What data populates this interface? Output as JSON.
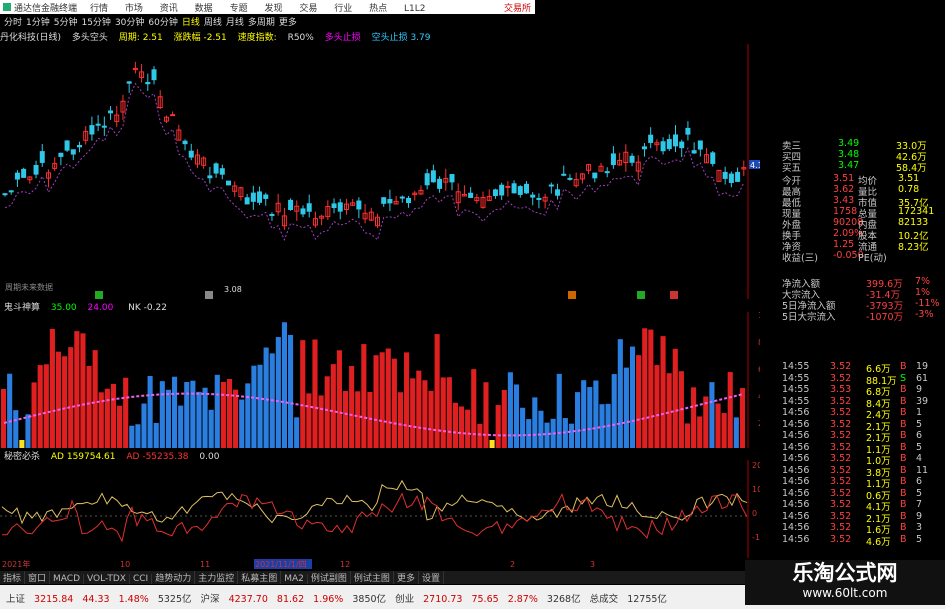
{
  "window": {
    "title": "通达信金融终端",
    "menu": [
      "行情",
      "市场",
      "资讯",
      "数据",
      "专题",
      "发现",
      "交易",
      "行业",
      "热点",
      "L1L2"
    ],
    "trade_link": "交易所"
  },
  "periods": {
    "items": [
      "分时",
      "1分钟",
      "5分钟",
      "15分钟",
      "30分钟",
      "60分钟",
      "日线",
      "周线",
      "月线",
      "多周期",
      "更多"
    ],
    "active": "日线"
  },
  "info": {
    "stock": "丹化科技(日线)",
    "indicator": "多头空头",
    "cycle": "周期: 2.51",
    "drop": "涨跌幅 -2.51",
    "speed": "速度指数:",
    "r50": "R50%",
    "bull": "多头止损",
    "bear": "空头止损 3.79"
  },
  "indicators": {
    "ind1_name": "鬼斗神算",
    "ind1_val1": "35.00",
    "ind1_val2": "24.00",
    "ind1_nk": "NK -0.22",
    "ind2_name": "秘密必杀",
    "ind2_ad": "AD 159754.61",
    "ind2_ad2": "AD -55235.38",
    "ind2_val": "0.00",
    "no_data": "周期未来数据"
  },
  "axis": {
    "price_ticks": [
      "4.20",
      "4.00",
      "3.80",
      "3.60",
      "3.40",
      "3.20"
    ],
    "price_tag": "4.16",
    "ind1_ticks": [
      "100.0",
      "80.00",
      "60.00",
      "40.00",
      "20.00"
    ],
    "ind2_ticks": [
      "20000",
      "10000",
      "0",
      "-10000"
    ],
    "date_labels": [
      "2021年",
      "10",
      "11",
      "2021/11/1/四",
      "12",
      "2",
      "3"
    ],
    "low_label": "3.08"
  },
  "quote": {
    "ask_rows": [
      {
        "label": "卖三",
        "price": "3.49",
        "vol": "33.0万"
      },
      {
        "label": "买四",
        "price": "3.48",
        "vol": "42.6万"
      },
      {
        "label": "买五",
        "price": "3.47",
        "vol": "58.4万"
      }
    ],
    "stats": [
      {
        "l1": "今开",
        "v1": "3.51",
        "l2": "均价",
        "v2": "3.51"
      },
      {
        "l1": "最高",
        "v1": "3.62",
        "l2": "量比",
        "v2": "0.78"
      },
      {
        "l1": "最低",
        "v1": "3.43",
        "l2": "市值",
        "v2": "35.7亿"
      },
      {
        "l1": "现量",
        "v1": "1758",
        "l2": "总量",
        "v2": "172341"
      },
      {
        "l1": "外盘",
        "v1": "90208",
        "l2": "内盘",
        "v2": "82133"
      },
      {
        "l1": "换手",
        "v1": "2.09%",
        "l2": "股本",
        "v2": "10.2亿"
      },
      {
        "l1": "净资",
        "v1": "1.25",
        "l2": "流通",
        "v2": "8.23亿"
      },
      {
        "l1": "收益(三)",
        "v1": "-0.050",
        "l2": "PE(动)",
        "v2": ""
      }
    ],
    "flows": [
      {
        "label": "净流入额",
        "value": "399.6万",
        "pct": "7%"
      },
      {
        "label": "大宗流入",
        "value": "-31.4万",
        "pct": "1%"
      },
      {
        "label": "5日净流入额",
        "value": "-3793万",
        "pct": "-11%"
      },
      {
        "label": "5日大宗流入",
        "value": "-1070万",
        "pct": "-3%"
      }
    ],
    "ticks": [
      {
        "time": "14:55",
        "price": "3.52",
        "vol": "6.6万",
        "bs": "B",
        "n": "19"
      },
      {
        "time": "14:55",
        "price": "3.52",
        "vol": "88.1万",
        "bs": "S",
        "n": "61"
      },
      {
        "time": "14:55",
        "price": "3.53",
        "vol": "6.8万",
        "bs": "B",
        "n": "9"
      },
      {
        "time": "14:55",
        "price": "3.52",
        "vol": "8.4万",
        "bs": "B",
        "n": "39"
      },
      {
        "time": "14:56",
        "price": "3.52",
        "vol": "2.4万",
        "bs": "B",
        "n": "1"
      },
      {
        "time": "14:56",
        "price": "3.52",
        "vol": "2.1万",
        "bs": "B",
        "n": "5"
      },
      {
        "time": "14:56",
        "price": "3.52",
        "vol": "2.1万",
        "bs": "B",
        "n": "6"
      },
      {
        "time": "14:56",
        "price": "3.52",
        "vol": "1.1万",
        "bs": "B",
        "n": "5"
      },
      {
        "time": "14:56",
        "price": "3.52",
        "vol": "1.0万",
        "bs": "B",
        "n": "4"
      },
      {
        "time": "14:56",
        "price": "3.52",
        "vol": "3.8万",
        "bs": "B",
        "n": "11"
      },
      {
        "time": "14:56",
        "price": "3.52",
        "vol": "1.1万",
        "bs": "B",
        "n": "6"
      },
      {
        "time": "14:56",
        "price": "3.52",
        "vol": "0.6万",
        "bs": "B",
        "n": "5"
      },
      {
        "time": "14:56",
        "price": "3.52",
        "vol": "4.1万",
        "bs": "B",
        "n": "7"
      },
      {
        "time": "14:56",
        "price": "3.52",
        "vol": "2.1万",
        "bs": "B",
        "n": "9"
      },
      {
        "time": "14:56",
        "price": "3.52",
        "vol": "1.6万",
        "bs": "B",
        "n": "3"
      },
      {
        "time": "14:56",
        "price": "3.52",
        "vol": "4.6万",
        "bs": "B",
        "n": "5"
      }
    ]
  },
  "bottom_tabs": [
    "指标",
    "窗口",
    "MACD",
    "VOL-TDX",
    "CCI",
    "趋势动力",
    "主力监控",
    "私募主图",
    "MA2",
    "例试副图",
    "例试主图",
    "更多",
    "设置"
  ],
  "status": {
    "sh_label": "上证",
    "sh_val": "3215.84",
    "sh_chg": "44.33",
    "sh_pct": "1.48%",
    "sh_amt": "5325亿",
    "sz_label": "沪深",
    "sz_val": "4237.70",
    "sz_chg": "81.62",
    "sz_pct": "1.96%",
    "sz_amt": "3850亿",
    "cy_label": "创业",
    "cy_val": "2710.73",
    "cy_chg": "75.65",
    "cy_pct": "2.87%",
    "cy_amt": "3268亿",
    "total_label": "总成交",
    "total_val": "12755亿"
  },
  "watermark": {
    "line1": "乐淘公式网",
    "line2": "www.60lt.com"
  },
  "colors": {
    "up": "#ff3030",
    "down": "#30c0e0",
    "bar_red": "#e02020",
    "bar_blue": "#2a7ee0",
    "bar_yellow": "#ffe020"
  }
}
